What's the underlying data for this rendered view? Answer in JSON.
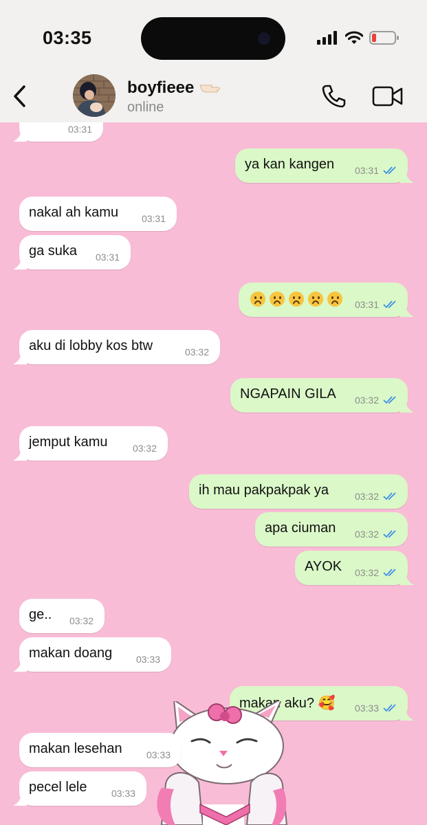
{
  "status_bar": {
    "time": "03:35"
  },
  "contact": {
    "name": "boyfieee",
    "presence": "online"
  },
  "messages": [
    {
      "dir": "in",
      "text": "",
      "time": "03:31"
    },
    {
      "dir": "out",
      "text": "ya kan kangen",
      "time": "03:31"
    },
    {
      "dir": "in",
      "text": "nakal ah kamu",
      "time": "03:31"
    },
    {
      "dir": "in",
      "text": "ga suka",
      "time": "03:31"
    },
    {
      "dir": "out",
      "text": "☹☹☹☹☹",
      "time": "03:31"
    },
    {
      "dir": "in",
      "text": "aku di lobby kos btw",
      "time": "03:32"
    },
    {
      "dir": "out",
      "text": "NGAPAIN GILA",
      "time": "03:32"
    },
    {
      "dir": "in",
      "text": "jemput kamu",
      "time": "03:32"
    },
    {
      "dir": "out",
      "text": "ih mau pakpakpak ya",
      "time": "03:32"
    },
    {
      "dir": "out",
      "text": "apa ciuman",
      "time": "03:32"
    },
    {
      "dir": "out",
      "text": "AYOK",
      "time": "03:32"
    },
    {
      "dir": "in",
      "text": "ge..",
      "time": "03:32"
    },
    {
      "dir": "in",
      "text": "makan doang",
      "time": "03:33"
    },
    {
      "dir": "out",
      "text": "makan aku? 🥰",
      "time": "03:33"
    },
    {
      "dir": "in",
      "text": "makan lesehan",
      "time": "03:33"
    },
    {
      "dir": "in",
      "text": "pecel lele",
      "time": "03:33"
    }
  ],
  "colors": {
    "chat_bg": "#f9bcd6",
    "incoming": "#ffffff",
    "outgoing": "#dbf8c8",
    "read_ticks": "#3d8fe6"
  }
}
